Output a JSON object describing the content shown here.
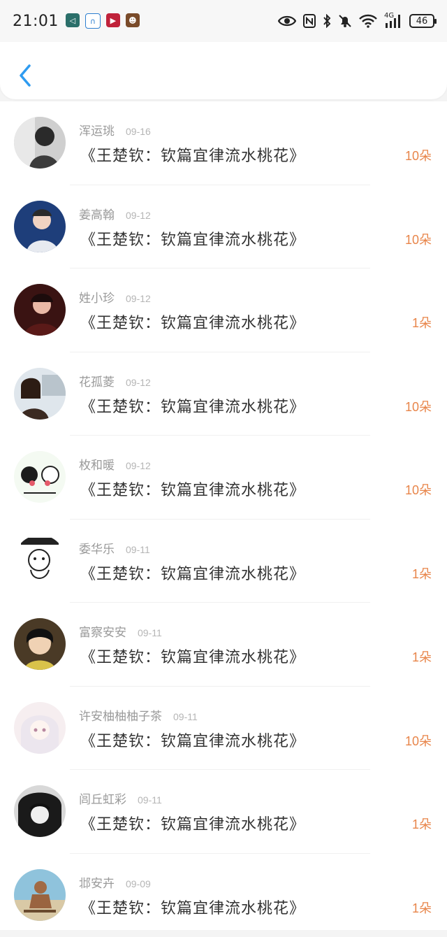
{
  "status_bar": {
    "time": "21:01",
    "battery": "46",
    "network": "4G"
  },
  "nav": {
    "back_icon": "chevron-left-icon",
    "accent": "#2e9bf0"
  },
  "colors": {
    "count": "#e8854a",
    "name": "#9a9a9a"
  },
  "items": [
    {
      "name": "浑运珧",
      "date": "09-16",
      "title": "《王楚钦：钦篇宜律流水桃花》",
      "count": "10朵"
    },
    {
      "name": "姜高翰",
      "date": "09-12",
      "title": "《王楚钦：钦篇宜律流水桃花》",
      "count": "10朵"
    },
    {
      "name": "姓小珍",
      "date": "09-12",
      "title": "《王楚钦：钦篇宜律流水桃花》",
      "count": "1朵"
    },
    {
      "name": "花孤菱",
      "date": "09-12",
      "title": "《王楚钦：钦篇宜律流水桃花》",
      "count": "10朵"
    },
    {
      "name": "枚和暖",
      "date": "09-12",
      "title": "《王楚钦：钦篇宜律流水桃花》",
      "count": "10朵"
    },
    {
      "name": "委华乐",
      "date": "09-11",
      "title": "《王楚钦：钦篇宜律流水桃花》",
      "count": "1朵"
    },
    {
      "name": "富察安安",
      "date": "09-11",
      "title": "《王楚钦：钦篇宜律流水桃花》",
      "count": "1朵"
    },
    {
      "name": "许安柚柚柚子茶",
      "date": "09-11",
      "title": "《王楚钦：钦篇宜律流水桃花》",
      "count": "10朵"
    },
    {
      "name": "闾丘虹彩",
      "date": "09-11",
      "title": "《王楚钦：钦篇宜律流水桃花》",
      "count": "1朵"
    },
    {
      "name": "邶安卉",
      "date": "09-09",
      "title": "《王楚钦：钦篇宜律流水桃花》",
      "count": "1朵"
    }
  ]
}
